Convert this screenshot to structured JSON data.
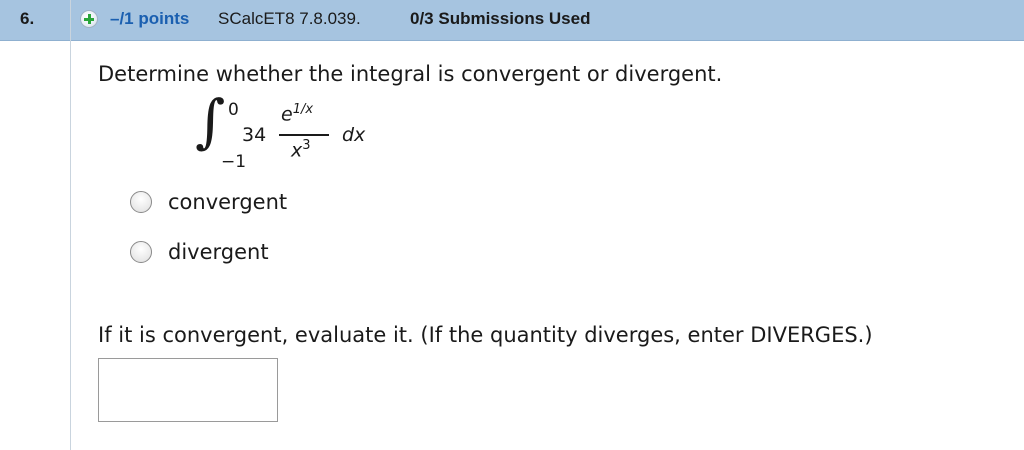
{
  "question": {
    "number": "6.",
    "points": "–/1 points",
    "code": "SCalcET8 7.8.039.",
    "submissions": "0/3 Submissions Used",
    "accent": "#1a5fb0",
    "header_bg": "#a6c4e0",
    "add_icon": "plus-circle-icon"
  },
  "prompt": "Determine whether the integral is convergent or divergent.",
  "integral": {
    "upper": "0",
    "lower": "−1",
    "coefficient": "34",
    "numerator_base": "e",
    "numerator_exp": "1/x",
    "denominator_base": "x",
    "denominator_exp": "3",
    "differential": "dx"
  },
  "options": [
    {
      "label": "convergent",
      "selected": false
    },
    {
      "label": "divergent",
      "selected": false
    }
  ],
  "instruction": "If it is convergent, evaluate it. (If the quantity diverges, enter DIVERGES.)",
  "answer": {
    "value": ""
  }
}
